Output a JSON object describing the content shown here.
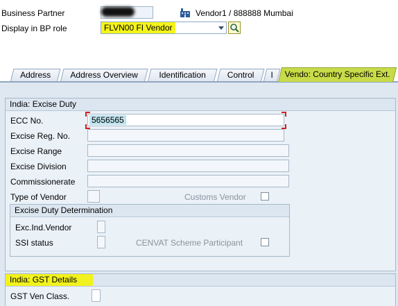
{
  "header": {
    "business_partner_label": "Business Partner",
    "vendor_title": "Vendor1 / 888888 Mumbai",
    "display_role_label": "Display in BP role",
    "role_value": "FLVN00 FI Vendor"
  },
  "tabs": [
    {
      "label": "Address"
    },
    {
      "label": "Address Overview"
    },
    {
      "label": "Identification"
    },
    {
      "label": "Control"
    },
    {
      "label": "I"
    },
    {
      "label": "Vendo: Country Specific Ext."
    }
  ],
  "excise": {
    "title": "India: Excise Duty",
    "ecc_label": "ECC No.",
    "ecc_value": "5656565",
    "reg_label": "Excise Reg. No.",
    "range_label": "Excise Range",
    "division_label": "Excise Division",
    "commissionerate_label": "Commissionerate",
    "type_label": "Type of Vendor",
    "customs_label": "Customs Vendor",
    "determination": {
      "title": "Excise Duty Determination",
      "exc_ind_label": "Exc.Ind.Vendor",
      "ssi_label": "SSI status",
      "cenvat_label": "CENVAT Scheme Participant"
    }
  },
  "gst": {
    "title": "India: GST Details",
    "class_label": "GST Ven Class."
  },
  "colors": {
    "highlight": "#f2f21e",
    "active_tab": "#c8db48",
    "panel": "#eaf1f7"
  }
}
